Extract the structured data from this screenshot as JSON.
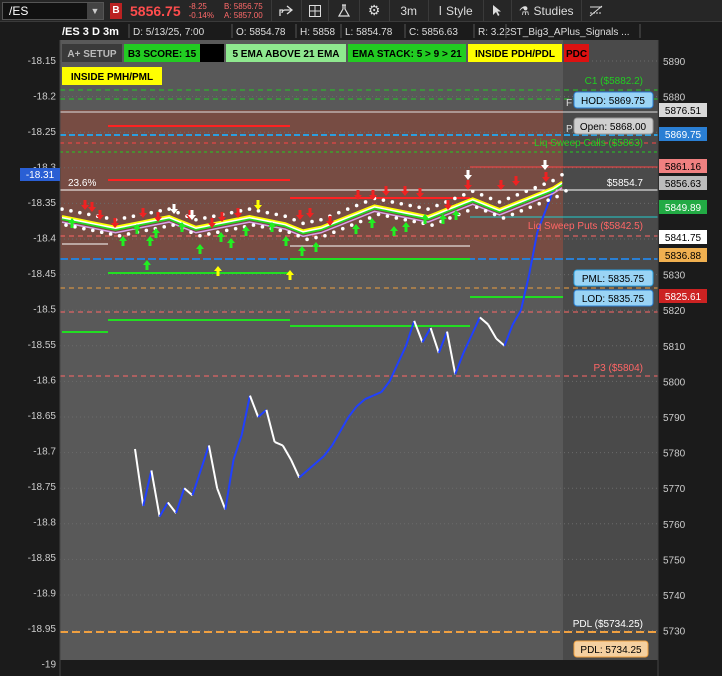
{
  "toolbar": {
    "symbol": "/ES",
    "badge": "B",
    "last": "5856.75",
    "net_change": "-8.25",
    "pct_change": "-0.14%",
    "bid": "B: 5856.75",
    "ask": "A: 5857.00",
    "timeframe": "3m",
    "style_label": "Style",
    "studies_label": "Studies"
  },
  "header": {
    "title": "/ES 3 D 3m",
    "date": "D: 5/13/25, 7:00",
    "open": "O: 5854.78",
    "high": "H: 5858",
    "low": "L: 5854.78",
    "close": "C: 5856.63",
    "range": "R: 3.22",
    "study_name": "ST_Big3_APlus_Signals ..."
  },
  "badges": [
    {
      "text": "A+ SETUP",
      "bg": "#3a3a3a",
      "fg": "#bbbbbb"
    },
    {
      "text": "B3 SCORE: 15",
      "bg": "#22cc22",
      "fg": "#000000"
    },
    {
      "text": "",
      "bg": "#000000",
      "fg": "#000000"
    },
    {
      "text": "5 EMA ABOVE 21 EMA",
      "bg": "#8fe88f",
      "fg": "#000000"
    },
    {
      "text": "EMA STACK: 5 > 9 > 21",
      "bg": "#22cc22",
      "fg": "#000000"
    },
    {
      "text": "INSIDE PDH/PDL",
      "bg": "#ffff00",
      "fg": "#000000"
    },
    {
      "text": "PDC",
      "bg": "#dd1111",
      "fg": "#000000"
    },
    {
      "text": "INSIDE PMH/PML",
      "bg": "#ffff00",
      "fg": "#000000"
    }
  ],
  "left_axis": {
    "ticks": [
      "-18.15",
      "-18.2",
      "-18.25",
      "-18.3",
      "-18.35",
      "-18.4",
      "-18.45",
      "-18.5",
      "-18.55",
      "-18.6",
      "-18.65",
      "-18.7",
      "-18.75",
      "-18.8",
      "-18.85",
      "-18.9",
      "-18.95",
      "-19"
    ],
    "current_marker": "-18.31"
  },
  "right_axis": {
    "ticks": [
      "5890",
      "5880",
      "5870",
      "5860",
      "5850",
      "5840",
      "5830",
      "5820",
      "5810",
      "5800",
      "5790",
      "5780",
      "5770",
      "5760",
      "5750",
      "5740",
      "5730"
    ],
    "flags": [
      {
        "text": "5876.51",
        "bg": "#d9d9d9",
        "fg": "#000000"
      },
      {
        "text": "5869.75",
        "bg": "#2a7fd4",
        "fg": "#ffffff"
      },
      {
        "text": "5861.16",
        "bg": "#f08080",
        "fg": "#000000"
      },
      {
        "text": "5856.63",
        "bg": "#bbbbbb",
        "fg": "#000000"
      },
      {
        "text": "5849.89",
        "bg": "#22aa44",
        "fg": "#ffffff"
      },
      {
        "text": "5841.75",
        "bg": "#ffffff",
        "fg": "#000000"
      },
      {
        "text": "5836.88",
        "bg": "#f0b050",
        "fg": "#000000"
      },
      {
        "text": "5825.61",
        "bg": "#cc2222",
        "fg": "#ffffff"
      }
    ]
  },
  "level_labels": {
    "c1": "C1 ($5882.2)",
    "hod": "HOD: 5869.75",
    "open_lbl": "Open: 5868.00",
    "price_5854": "$5854.7",
    "fib_236": "23.6%",
    "liq_calls": "Liq Sweep Calls ($5863)",
    "liq_puts": "Liq Sweep Puts ($5842.5)",
    "pml": "PML: 5835.75",
    "lod": "LOD: 5835.75",
    "p3": "P3 ($5804)",
    "pdl_line": "PDL ($5734.25)",
    "pdl_box": "PDL: 5734.25",
    "hod_prefix": "P",
    "open_prefix": "F"
  },
  "colors": {
    "bull_line": "#2040ff",
    "bear_line": "#ffffff",
    "zone": "#7a4a40",
    "ema5": "#ffff00",
    "ema9": "#22dd22",
    "ema21": "#ffffff",
    "buy_arrow": "#22ee22",
    "sell_arrow": "#ee2222"
  },
  "series": {
    "upper_left_close": [
      5847,
      5846.5,
      5846,
      5845.5,
      5845,
      5844.5,
      5844,
      5844.5,
      5845,
      5845.5,
      5846,
      5846.5,
      5847,
      5846,
      5845,
      5844,
      5844.5,
      5845,
      5845.5,
      5846,
      5846.5,
      5847,
      5846.5,
      5846,
      5845.5,
      5845,
      5844,
      5843,
      5843.5,
      5844,
      5845,
      5846,
      5847,
      5848,
      5849,
      5850,
      5849.5,
      5849,
      5848.5,
      5848,
      5847.5,
      5847,
      5848,
      5849,
      5850,
      5851,
      5852,
      5851,
      5850,
      5849,
      5850,
      5851,
      5852,
      5853,
      5854,
      5855,
      5856.63
    ],
    "lower_price": [
      5781,
      5765,
      5775,
      5762,
      5766,
      5763,
      5770,
      5768,
      5775,
      5782,
      5770,
      5764,
      5778,
      5785,
      5796,
      5790,
      5792,
      5783,
      5782,
      5778,
      5773,
      5775,
      5777,
      5779,
      5782,
      5786,
      5790,
      5793,
      5795,
      5796,
      5797,
      5800,
      5805,
      5810,
      5817,
      5811,
      5815,
      5808,
      5814,
      5802,
      5808,
      5813,
      5818,
      5816,
      5812,
      5810,
      5816,
      5820,
      5830,
      5842,
      5848,
      5854,
      5856
    ]
  }
}
